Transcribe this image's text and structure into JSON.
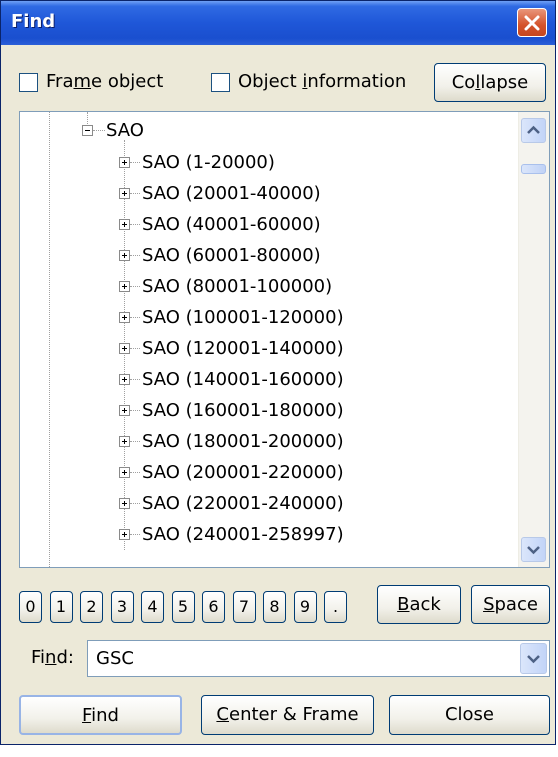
{
  "window": {
    "title": "Find"
  },
  "options": {
    "frame_object_label_pre": "Fra",
    "frame_object_label_ul": "m",
    "frame_object_label_post": "e object",
    "frame_object_checked": false,
    "object_information_label_pre": "Object ",
    "object_information_label_ul": "i",
    "object_information_label_post": "nformation",
    "object_information_checked": false,
    "collapse_label_pre": "Co",
    "collapse_label_ul": "l",
    "collapse_label_post": "lapse"
  },
  "tree": {
    "root": {
      "label": "SAO",
      "expanded": true
    },
    "children": [
      "SAO (1-20000)",
      "SAO (20001-40000)",
      "SAO (40001-60000)",
      "SAO (60001-80000)",
      "SAO (80001-100000)",
      "SAO (100001-120000)",
      "SAO (120001-140000)",
      "SAO (140001-160000)",
      "SAO (160001-180000)",
      "SAO (180001-200000)",
      "SAO (200001-220000)",
      "SAO (220001-240000)",
      "SAO (240001-258997)"
    ]
  },
  "keypad": {
    "keys": [
      "0",
      "1",
      "2",
      "3",
      "4",
      "5",
      "6",
      "7",
      "8",
      "9",
      "."
    ],
    "back_pre": "",
    "back_ul": "B",
    "back_post": "ack",
    "space_pre": "",
    "space_ul": "S",
    "space_post": "pace"
  },
  "find": {
    "label_pre": "Fi",
    "label_ul": "n",
    "label_post": "d:",
    "value": "GSC"
  },
  "buttons": {
    "find_pre": "",
    "find_ul": "F",
    "find_post": "ind",
    "center_pre": "",
    "center_ul": "C",
    "center_post": "enter & Frame",
    "close": "Close"
  },
  "colors": {
    "titlebar": "#1f57d8",
    "window_bg": "#ece9d8",
    "close_button": "#d4532b"
  }
}
